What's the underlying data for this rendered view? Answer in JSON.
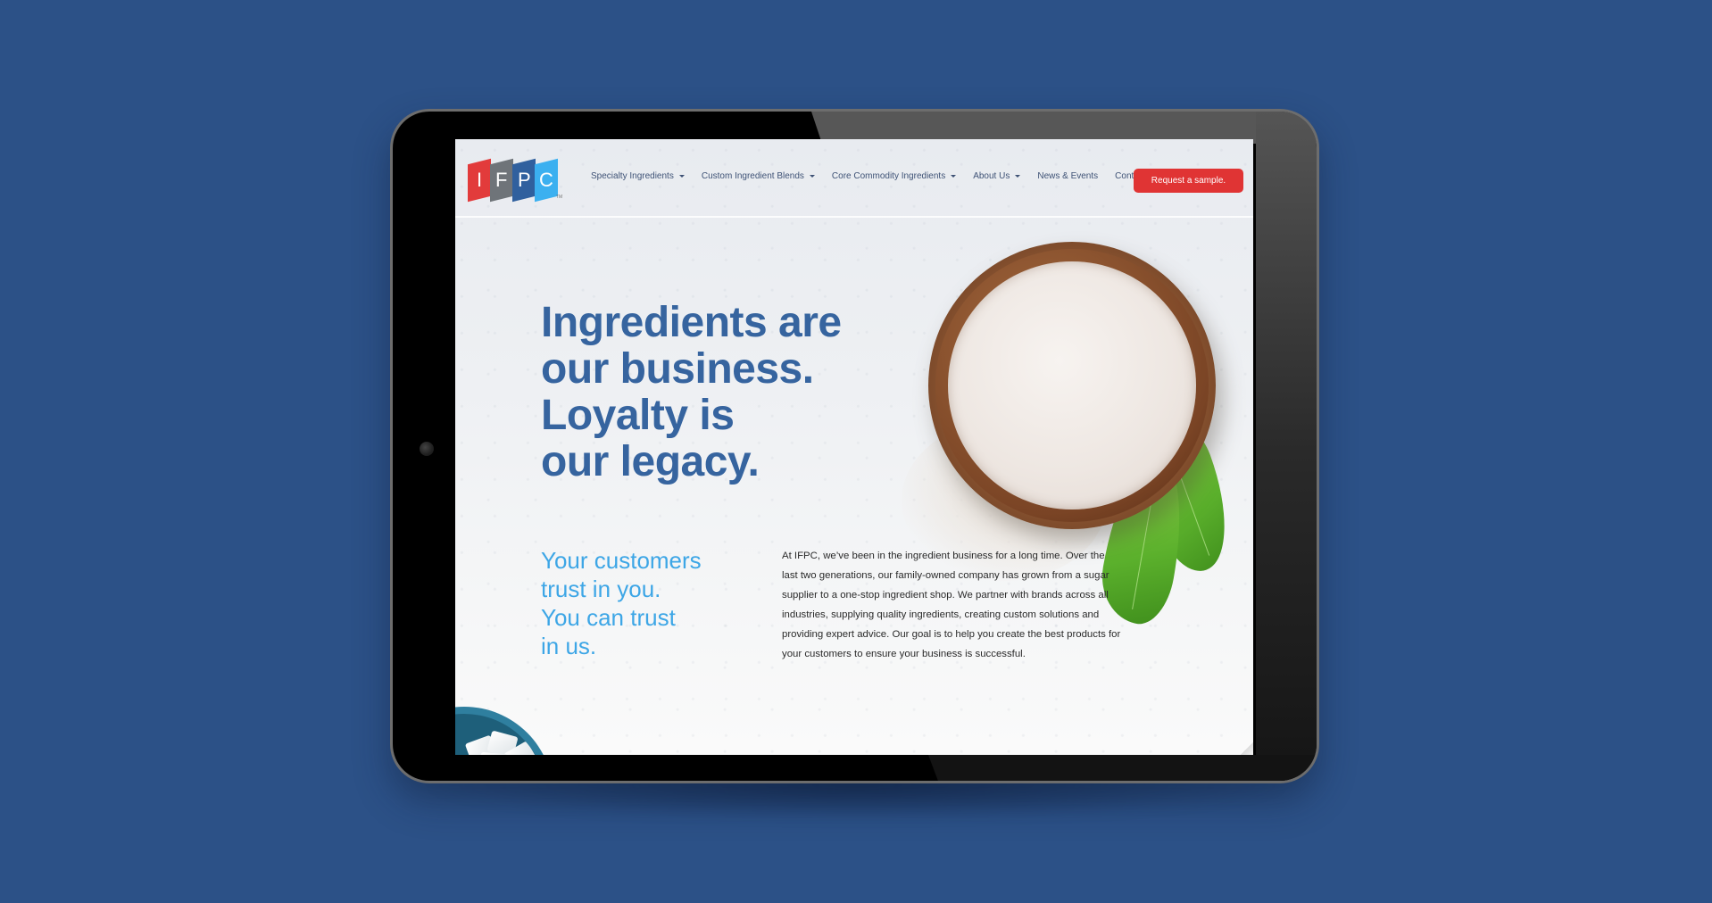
{
  "device": {
    "type": "tablet",
    "background_color": "#2c5187"
  },
  "site": {
    "logo": {
      "letters": [
        "I",
        "F",
        "P",
        "C"
      ],
      "tile_colors": [
        "#e23b3b",
        "#6f7479",
        "#30609e",
        "#3bb0f0"
      ],
      "trademark": "TM"
    },
    "nav": {
      "items": [
        {
          "label": "Specialty Ingredients",
          "has_dropdown": true
        },
        {
          "label": "Custom Ingredient Blends",
          "has_dropdown": true
        },
        {
          "label": "Core Commodity Ingredients",
          "has_dropdown": true
        },
        {
          "label": "About Us",
          "has_dropdown": true
        },
        {
          "label": "News & Events",
          "has_dropdown": false
        },
        {
          "label": "Contact",
          "has_dropdown": false
        }
      ],
      "cta_label": "Request a sample.",
      "cta_color": "#e03434"
    },
    "hero": {
      "headline_lines": [
        "Ingredients are",
        "our business.",
        "Loyalty is",
        "our legacy."
      ],
      "headline_color": "#36649f",
      "subhead_lines": [
        "Your customers",
        "trust in you.",
        "You can trust",
        "in us."
      ],
      "subhead_color": "#3da6e6",
      "body": "At IFPC, we’ve been in the ingredient business for a long time. Over the last two generations, our family-owned company has grown from a sugar supplier to a one-stop ingredient shop. We partner with brands across all industries, supplying quality ingredients, creating custom solutions and providing expert advice. Our goal is to help you create the best products for your customers to ensure your business is successful.",
      "images": [
        "wooden-bowl-of-flour",
        "stevia-leaves",
        "bowl-of-sugar-cubes"
      ]
    }
  }
}
